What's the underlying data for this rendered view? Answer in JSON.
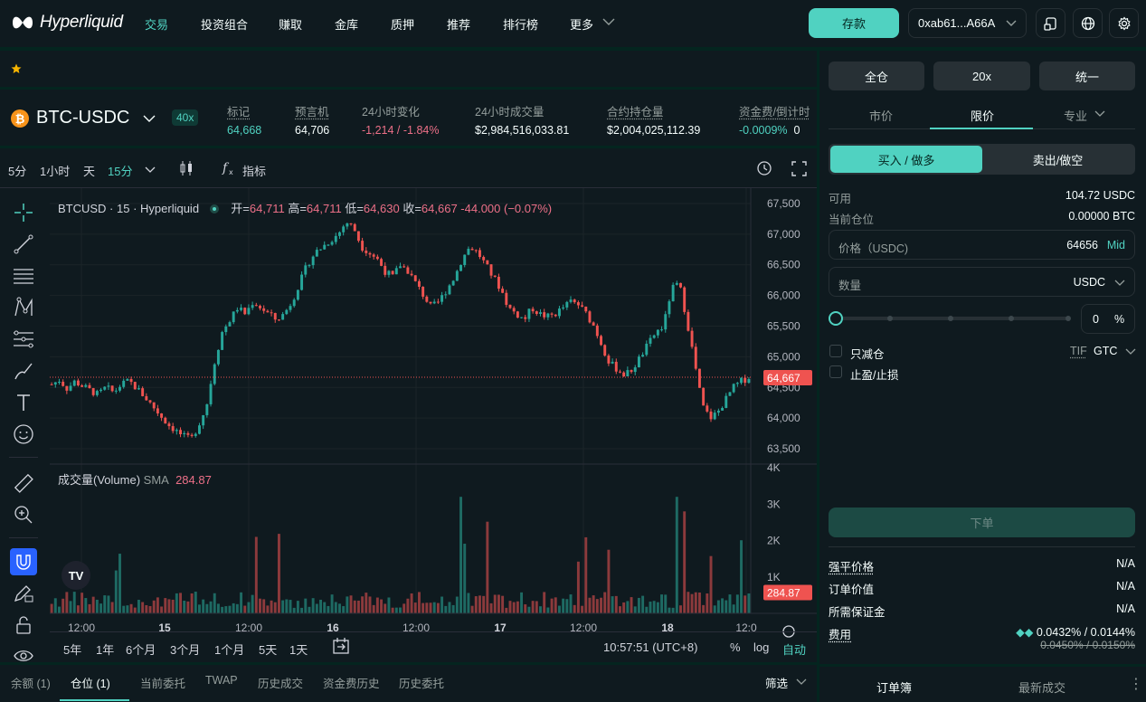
{
  "colors": {
    "accent": "#50d2c1",
    "down": "#ed7088",
    "panel": "#0f1a1f",
    "bg": "#04251f"
  },
  "nav": {
    "logo": "Hyperliquid",
    "items": [
      "交易",
      "投资组合",
      "赚取",
      "金库",
      "质押",
      "推荐",
      "排行榜",
      "更多"
    ],
    "deposit": "存款",
    "wallet": "0xab61...A66A",
    "icons": [
      "mobile-icon",
      "globe-icon",
      "gear-icon"
    ]
  },
  "market": {
    "pair": "BTC-USDC",
    "leverage": "40x",
    "stats": [
      {
        "label": "标记",
        "value": "64,668",
        "color": "green"
      },
      {
        "label": "预言机",
        "value": "64,706",
        "color": "white"
      },
      {
        "label": "24小时变化",
        "value": "-1,214 / -1.84%",
        "color": "red"
      },
      {
        "label": "24小时成交量",
        "value": "$2,984,516,033.81",
        "color": "white"
      },
      {
        "label": "合约持仓量",
        "value": "$2,004,025,112.39",
        "color": "white"
      },
      {
        "label": "资金费/倒计时",
        "value": "-0.0009%",
        "value2": "0",
        "color": "green"
      }
    ]
  },
  "chart_toolbar": {
    "intervals": [
      "5分",
      "1小时",
      "天",
      "15分"
    ],
    "indicators": "指标"
  },
  "chart_data": {
    "type": "candlestick",
    "symbol": "BTCUSD · 15 · Hyperliquid",
    "ohlc": {
      "open_label": "开=",
      "open": "64,711",
      "high_label": "高=",
      "high": "64,711",
      "low_label": "低=",
      "low": "64,630",
      "close_label": "收=",
      "close": "64,667",
      "change": "-44.000 (−0.07%)"
    },
    "y_ticks": [
      "67,500",
      "67,000",
      "66,500",
      "66,000",
      "65,500",
      "65,000",
      "64,500",
      "64,000",
      "63,500"
    ],
    "last_price": "64,667",
    "volume_title": "成交量(Volume)",
    "volume_sma": "SMA",
    "volume_value": "284.87",
    "volume_ticks": [
      "4K",
      "3K",
      "2K",
      "1K"
    ],
    "x_ticks": [
      "12:00",
      "15",
      "12:00",
      "16",
      "12:00",
      "17",
      "12:00",
      "18",
      "12:0"
    ],
    "price_path": [
      64550,
      64620,
      64480,
      64600,
      64520,
      64450,
      64380,
      64500,
      64420,
      64550,
      64600,
      64480,
      64350,
      64200,
      64050,
      63900,
      63800,
      63700,
      63650,
      63900,
      64200,
      64900,
      65400,
      65600,
      65800,
      65700,
      65900,
      65800,
      65700,
      65600,
      65700,
      65900,
      66200,
      66500,
      66700,
      66800,
      66900,
      67000,
      67200,
      67100,
      66800,
      66700,
      66600,
      66400,
      66300,
      66500,
      66400,
      66200,
      66000,
      65800,
      65900,
      66100,
      66300,
      66600,
      66800,
      66700,
      66500,
      66300,
      66100,
      65800,
      65700,
      65600,
      65800,
      65700,
      65650,
      65700,
      65800,
      65900,
      65850,
      65700,
      65500,
      65200,
      64900,
      64800,
      64700,
      64800,
      65000,
      65200,
      65400,
      65500,
      66100,
      66200,
      65600,
      64900,
      64200,
      64000,
      64100,
      64300,
      64500,
      64600,
      64667
    ]
  },
  "chart_bottom": {
    "ranges": [
      "5年",
      "1年",
      "6个月",
      "3个月",
      "1个月",
      "5天",
      "1天"
    ],
    "time": "10:57:51 (UTC+8)",
    "pct": "%",
    "log": "log",
    "auto": "自动"
  },
  "bottom_tabs": [
    "余额 (1)",
    "仓位 (1)",
    "当前委托",
    "TWAP",
    "历史成交",
    "资金费历史",
    "历史委托"
  ],
  "bottom_filter": "筛选",
  "order": {
    "margin": "全仓",
    "lev": "20x",
    "mode": "统一",
    "types": [
      "市价",
      "限价",
      "专业"
    ],
    "buy": "买入 / 做多",
    "sell": "卖出/做空",
    "available_label": "可用",
    "available": "104.72 USDC",
    "position_label": "当前仓位",
    "position": "0.00000 BTC",
    "price_label": "价格（USDC)",
    "price": "64656",
    "mid": "Mid",
    "qty_label": "数量",
    "qty_unit": "USDC",
    "slider_pct": "0",
    "pct_sign": "%",
    "reduce_only": "只减仓",
    "tp_sl": "止盈/止损",
    "tif_label": "TIF",
    "tif": "GTC",
    "submit": "下单",
    "liq_label": "强平价格",
    "liq": "N/A",
    "value_label": "订单价值",
    "value": "N/A",
    "margin_label": "所需保证金",
    "margin_req": "N/A",
    "fee_label": "费用",
    "fee": "0.0432% / 0.0144%",
    "fee_old": "0.0450% / 0.0150%"
  },
  "orderbook_tabs": [
    "订单簿",
    "最新成交"
  ]
}
